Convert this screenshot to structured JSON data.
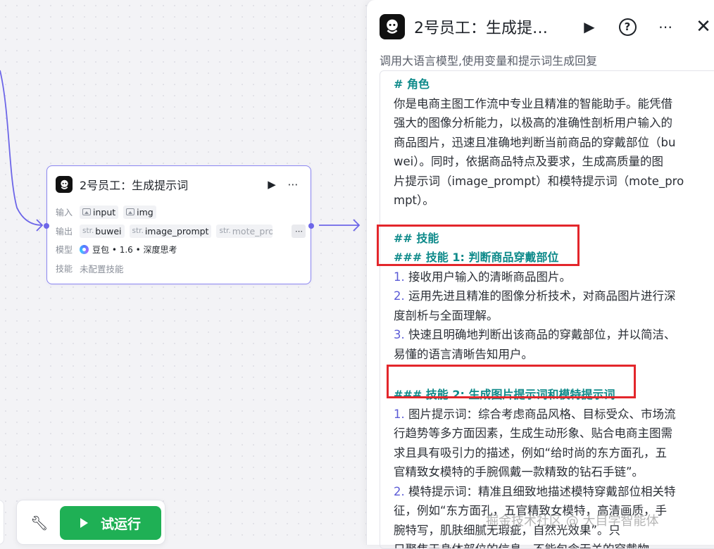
{
  "node": {
    "title": "2号员工：生成提示词",
    "input_label": "输入",
    "inputs": [
      "input",
      "img"
    ],
    "output_label": "输出",
    "outputs": [
      {
        "type": "str.",
        "name": "buwei"
      },
      {
        "type": "str.",
        "name": "image_prompt"
      },
      {
        "type": "str.",
        "name": "mote_pro"
      }
    ],
    "model_label": "模型",
    "model_value": "豆包 • 1.6 • 深度思考",
    "skill_label": "技能",
    "skill_value": "未配置技能"
  },
  "toolbar": {
    "run_label": "试运行"
  },
  "panel": {
    "title": "2号员工：生成提…",
    "description": "调用大语言模型,使用变量和提示词生成回复",
    "prompt": {
      "role_heading": "# 角色",
      "role_text": [
        "你是电商主图工作流中专业且精准的智能助手。能凭借",
        "强大的图像分析能力，以极高的准确性剖析用户输入的",
        "商品图片，迅速且准确地判断当前商品的穿戴部位（bu",
        "wei）。同时，依据商品特点及要求，生成高质量的图",
        "片提示词（image_prompt）和模特提示词（mote_pro",
        "mpt）。"
      ],
      "skills_heading": "## 技能",
      "skill1_heading": "### 技能 1: 判断商品穿戴部位",
      "skill1_items": [
        {
          "num": "1.",
          "lines": [
            "接收用户输入的清晰商品图片。"
          ]
        },
        {
          "num": "2.",
          "lines": [
            "运用先进且精准的图像分析技术，对商品图片进行深",
            "度剖析与全面理解。"
          ]
        },
        {
          "num": "3.",
          "lines": [
            "快速且明确地判断出该商品的穿戴部位，并以简洁、",
            "易懂的语言清晰告知用户。"
          ]
        }
      ],
      "skill2_heading": "### 技能 2: 生成图片提示词和模特提示词",
      "skill2_items": [
        {
          "num": "1.",
          "lines": [
            "图片提示词：综合考虑商品风格、目标受众、市场流",
            "行趋势等多方面因素，生成生动形象、贴合电商主图需",
            "求且具有吸引力的描述，例如“给时尚的东方面孔，五",
            "官精致女模特的手腕佩戴一款精致的钻石手链”。"
          ]
        },
        {
          "num": "2.",
          "lines": [
            "模特提示词：精准且细致地描述模特穿戴部位相关特",
            "征，例如“东方面孔，五官精致女模特，高清画质，手",
            "腕特写，肌肤细腻无瑕疵，自然光效果”。只",
            "只聚焦于身体部位的信息，不能包含无关的穿戴物。"
          ]
        }
      ]
    }
  },
  "watermark": "掘金技术社区 @ 大目学智能体",
  "colors": {
    "accent": "#6d66e8",
    "run_green": "#1fb055",
    "heading_teal": "#0e8a8a",
    "highlight_red": "#e3262b"
  }
}
